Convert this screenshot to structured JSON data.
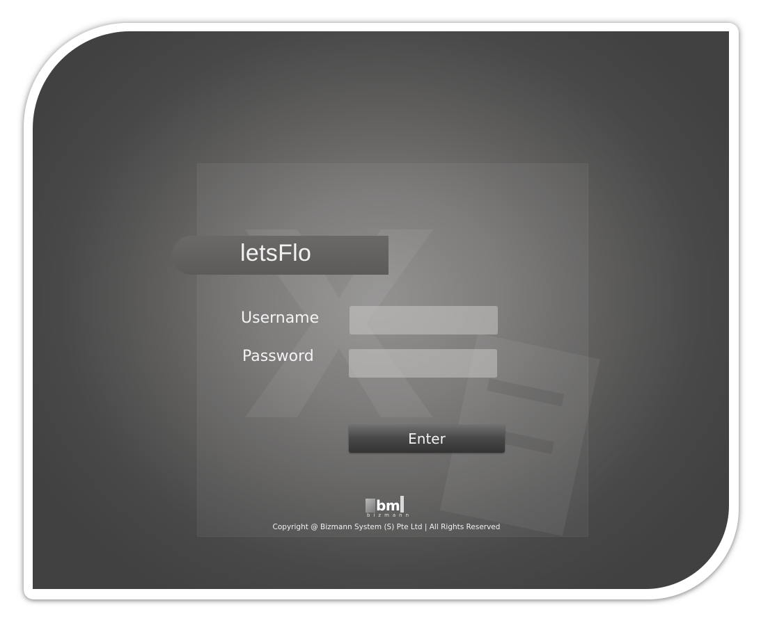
{
  "app": {
    "title": "letsFlo"
  },
  "login": {
    "username_label": "Username",
    "password_label": "Password",
    "username_value": "",
    "password_value": "",
    "enter_label": "Enter"
  },
  "footer": {
    "logo_text": "bm",
    "logo_subtext": "bizmann",
    "copyright": "Copyright @ Bizmann System (S) Pte Ltd | All Rights Reserved"
  },
  "colors": {
    "background_dark": "#414141",
    "background_light": "#8e8c8a",
    "button": "#4a4a4a",
    "text": "#f2f2f2"
  }
}
